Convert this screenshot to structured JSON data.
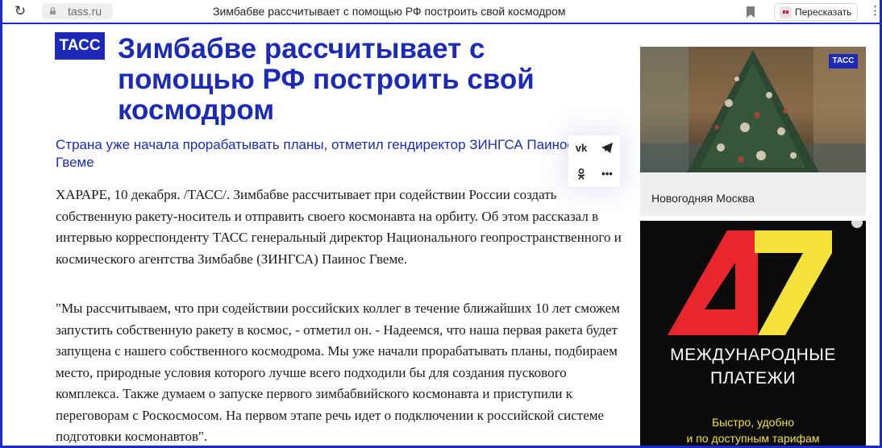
{
  "browser": {
    "url": "tass.ru",
    "tab_title": "Зимбабве рассчитывает с помощью РФ построить свой космодром",
    "retell_label": "Пересказать",
    "menu_glyph": "⋮",
    "reload_glyph": "↻"
  },
  "article": {
    "logo": "ТАСС",
    "headline": "Зимбабве рассчитывает с помощью РФ построить свой космодром",
    "subheadline": "Страна уже начала прорабатывать планы, отметил гендиректор ЗИНГСА Паинос Гвеме",
    "paragraphs": [
      "ХАРАРЕ, 10 декабря. /ТАСС/. Зимбабве рассчитывает при содействии России создать собственную ракету-носитель и отправить своего космонавта на орбиту. Об этом рассказал в интервью корреспонденту ТАСС генеральный директор Национального геопространственного и космического агентства Зимбабве (ЗИНГСА) Паинос Гвеме.",
      "\"Мы рассчитываем, что при содействии российских коллег в течение ближайших 10 лет сможем запустить собственную ракету в космос, - отметил он. - Надеемся, что наша первая ракета будет запущена с нашего собственного космодрома. Мы уже начали прорабатывать планы, подбираем место, природные условия которого лучше всего подходили бы для создания пускового комплекса. Также думаем о запуске первого зимбабвийского космонавта и приступили к переговорам с Роскосмосом. На первом этапе речь идет о подключении к российской системе подготовки космонавтов\"."
    ]
  },
  "share": {
    "vk": "vk",
    "more": "•••"
  },
  "sidebar": {
    "card_logo": "ТАСС",
    "card_caption": "Новогодняя Москва",
    "ad_headline": "МЕЖДУНАРОДНЫЕ\nПЛАТЕЖИ",
    "ad_subline": "Быстро, удобно\nи по доступным тарифам",
    "colors": {
      "ad_red": "#e8262b",
      "ad_yellow": "#f4e23b",
      "brand_blue": "#1b2bb7"
    }
  }
}
